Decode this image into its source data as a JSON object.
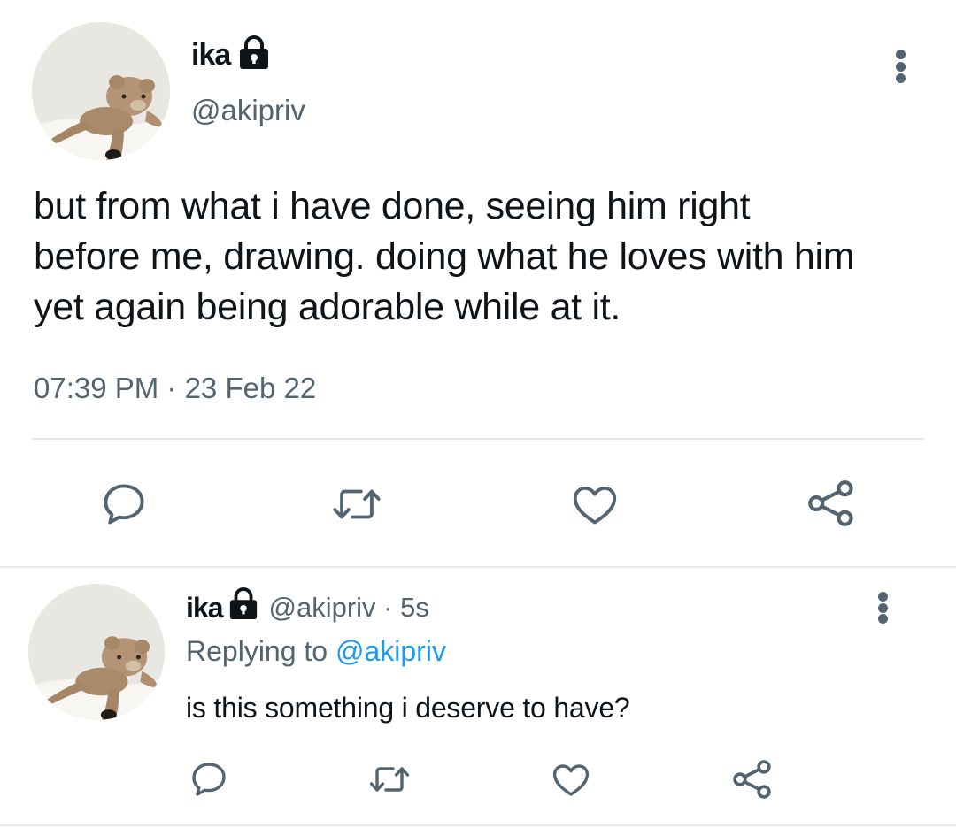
{
  "main_tweet": {
    "display_name": "ika",
    "handle": "@akipriv",
    "text_lines": [
      "but from what i have done, seeing him right",
      "before me, drawing. doing what he loves with him",
      "yet again being adorable while at it."
    ],
    "timestamp": "07:39 PM · 23 Feb 22"
  },
  "reply_tweet": {
    "display_name": "ika",
    "meta": "@akipriv · 5s",
    "replying_prefix": "Replying to ",
    "replying_handle": "@akipriv",
    "text": "is this something i deserve to have?"
  },
  "icons": {
    "protected": "lock-icon",
    "menu": "more-vertical-icon",
    "reply": "reply-icon",
    "retweet": "retweet-icon",
    "like": "heart-icon",
    "share": "share-icon"
  },
  "colors": {
    "text": "#0f1419",
    "muted": "#536471",
    "link": "#1d9bf0",
    "divider": "#e6e8ea"
  }
}
